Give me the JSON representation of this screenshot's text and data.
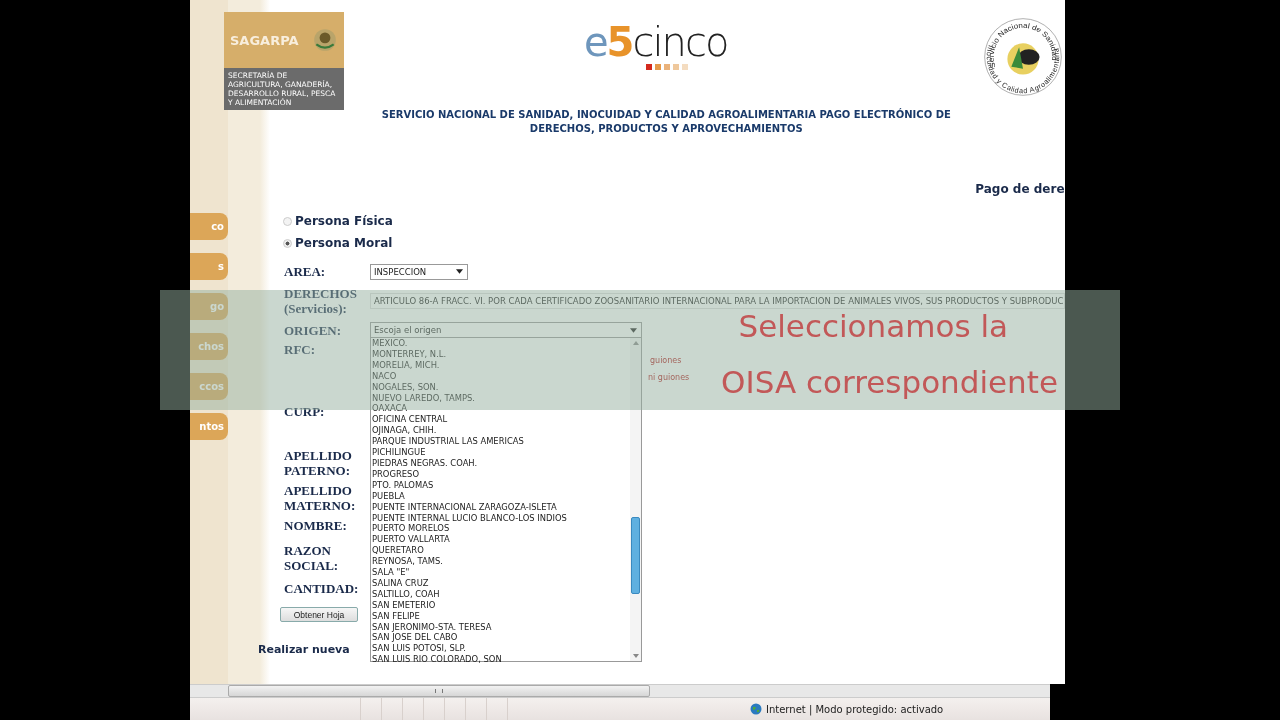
{
  "header": {
    "agency_logo": {
      "name": "SAGARPA",
      "subtitle": "SECRETARÍA DE AGRICULTURA, GANADERÍA, DESARROLLO RURAL, PESCA Y ALIMENTACIÓN"
    },
    "brand_parts": [
      "e",
      "5",
      "cinco"
    ],
    "seal": {
      "top": "Servicio Nacional de Sanidad",
      "bottom": "Inocuidad y Calidad Agroalimentaria"
    },
    "title": "SERVICIO NACIONAL DE SANIDAD, INOCUIDAD Y CALIDAD AGROALIMENTARIA PAGO ELECTRÓNICO DE DERECHOS, PRODUCTOS Y APROVECHAMIENTOS",
    "section": "Pago de dere"
  },
  "sidebar": {
    "items": [
      "co",
      "s",
      "go",
      "chos",
      "ccos",
      "ntos"
    ]
  },
  "person_type": [
    {
      "label": "Persona Física",
      "selected": false
    },
    {
      "label": "Persona Moral",
      "selected": true
    }
  ],
  "form": {
    "area": {
      "label": "AREA:",
      "value": "INSPECCION"
    },
    "derechos": {
      "label": "DERECHOS (Servicios):",
      "value": "ARTICULO 86-A FRACC. VI. POR CADA CERTIFICADO ZOOSANITARIO INTERNACIONAL PARA LA IMPORTACION DE ANIMALES VIVOS, SUS PRODUCTOS Y SUBPRODUC"
    },
    "origen": {
      "label": "ORIGEN:",
      "value": "Escoja el origen",
      "expanded": true,
      "options": [
        "MEXICO.",
        "MONTERREY, N.L.",
        "MORELIA, MICH.",
        "NACO",
        "NOGALES, SON.",
        "NUEVO LAREDO, TAMPS.",
        "OAXACA",
        "OFICINA CENTRAL",
        "OJINAGA, CHIH.",
        "PARQUE INDUSTRIAL LAS AMERICAS",
        "PICHILINGUE",
        "PIEDRAS NEGRAS. COAH.",
        "PROGRESO",
        "PTO. PALOMAS",
        "PUEBLA",
        "PUENTE INTERNACIONAL ZARAGOZA-ISLETA",
        "PUENTE INTERNAL LUCIO BLANCO-LOS INDIOS",
        "PUERTO MORELOS",
        "PUERTO VALLARTA",
        "QUERETARO",
        "REYNOSA, TAMS.",
        "SALA \"E\"",
        "SALINA CRUZ",
        "SALTILLO, COAH",
        "SAN EMETERIO",
        "SAN FELIPE",
        "SAN JERONIMO-STA. TERESA",
        "SAN JOSE DEL CABO",
        "SAN LUIS POTOSI, SLP.",
        "SAN LUIS RIO COLORADO, SON"
      ]
    },
    "rfc": {
      "label": "RFC:",
      "hints": [
        "guiones",
        "ni guiones"
      ]
    },
    "curp": {
      "label": "CURP:"
    },
    "apellido_paterno": {
      "label": "APELLIDO PATERNO:"
    },
    "apellido_materno": {
      "label": "APELLIDO MATERNO:"
    },
    "nombre": {
      "label": "NOMBRE:"
    },
    "razon_social": {
      "label": "RAZON SOCIAL:"
    },
    "cantidad": {
      "label": "CANTIDAD:"
    },
    "submit": "Obtener Hoja",
    "new_capture": "Realizar nueva"
  },
  "caption": [
    "Seleccionamos la",
    "OISA correspondiente"
  ],
  "status_bar": {
    "zone": "Internet | Modo protegido: activado"
  }
}
